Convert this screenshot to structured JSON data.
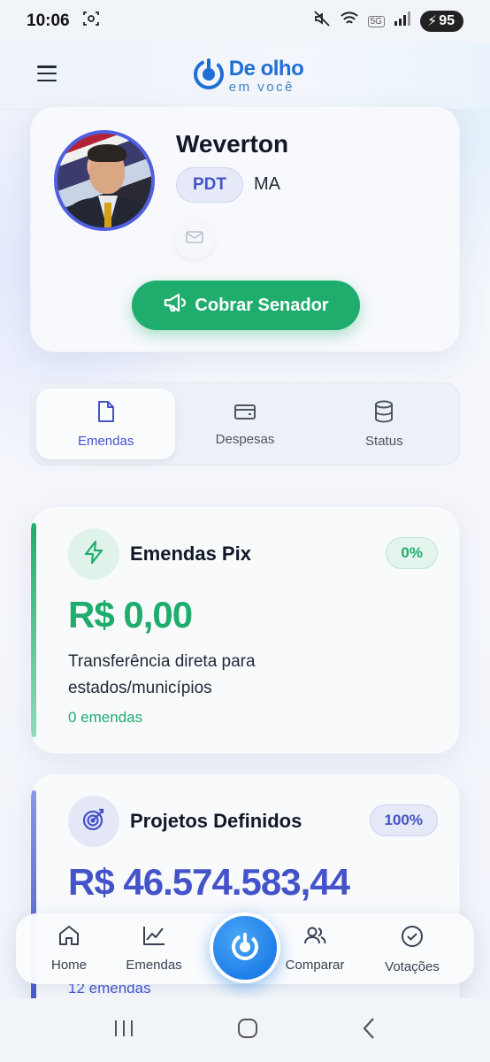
{
  "status_bar": {
    "time": "10:06",
    "battery": "95",
    "network": "5G"
  },
  "header": {
    "logo_title": "De olho",
    "logo_subtitle": "em você"
  },
  "profile": {
    "name": "Weverton",
    "party": "PDT",
    "state": "MA",
    "cta_label": "Cobrar Senador"
  },
  "tabs": [
    {
      "label": "Emendas",
      "icon": "file-icon",
      "active": true
    },
    {
      "label": "Despesas",
      "icon": "wallet-icon",
      "active": false
    },
    {
      "label": "Status",
      "icon": "database-icon",
      "active": false
    }
  ],
  "cards": {
    "pix": {
      "title": "Emendas Pix",
      "percent": "0%",
      "value": "R$ 0,00",
      "description": "Transferência direta para estados/municípios",
      "count": "0 emendas",
      "color": "#1fad6e"
    },
    "projetos": {
      "title": "Projetos Definidos",
      "percent": "100%",
      "value": "R$ 46.574.583,44",
      "count": "12 emendas",
      "color": "#4453c9"
    }
  },
  "bottom_nav": [
    {
      "label": "Home",
      "icon": "home-icon"
    },
    {
      "label": "Emendas",
      "icon": "chart-icon"
    },
    {
      "label": "Comparar",
      "icon": "users-icon"
    },
    {
      "label": "Votações",
      "icon": "check-circle-icon"
    }
  ]
}
